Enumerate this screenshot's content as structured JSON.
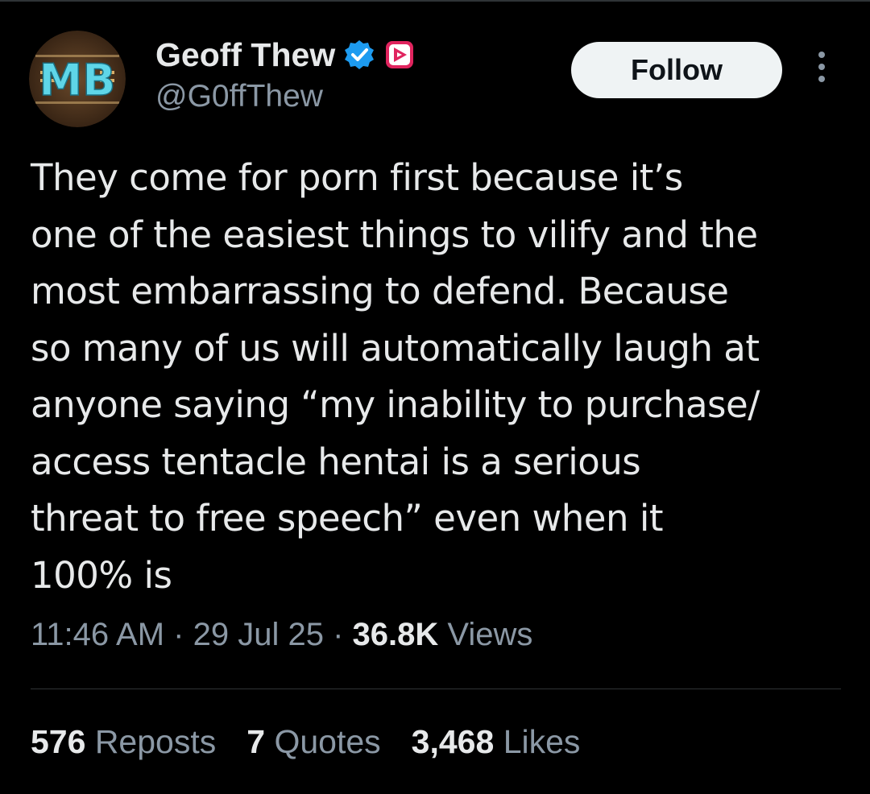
{
  "author": {
    "display_name": "Geoff Thew",
    "handle": "@G0ffThew",
    "avatar_text": "MB",
    "verified_badge_icon": "verified-badge-icon",
    "affiliate_badge_icon": "play-badge-icon"
  },
  "actions": {
    "follow_label": "Follow",
    "more_icon": "more-vertical-icon"
  },
  "tweet": {
    "text": "They come for porn first because it’s\none of the easiest things to vilify and the\nmost embarrassing to defend. Because\nso many of us will automatically laugh at\nanyone saying “my inability to purchase/\naccess tentacle hentai is a serious\nthreat to free speech” even when it\n100% is"
  },
  "meta": {
    "time": "11:46 AM",
    "sep1": "·",
    "date": "29 Jul 25",
    "sep2": "·",
    "views_count": "36.8K",
    "views_label": "Views"
  },
  "stats": {
    "reposts_count": "576",
    "reposts_label": "Reposts",
    "quotes_count": "7",
    "quotes_label": "Quotes",
    "likes_count": "3,468",
    "likes_label": "Likes"
  },
  "colors": {
    "background": "#000000",
    "text": "#e7e9ea",
    "muted": "#8b98a5",
    "verified": "#1d9bf0",
    "affiliate": "#e0245e"
  }
}
